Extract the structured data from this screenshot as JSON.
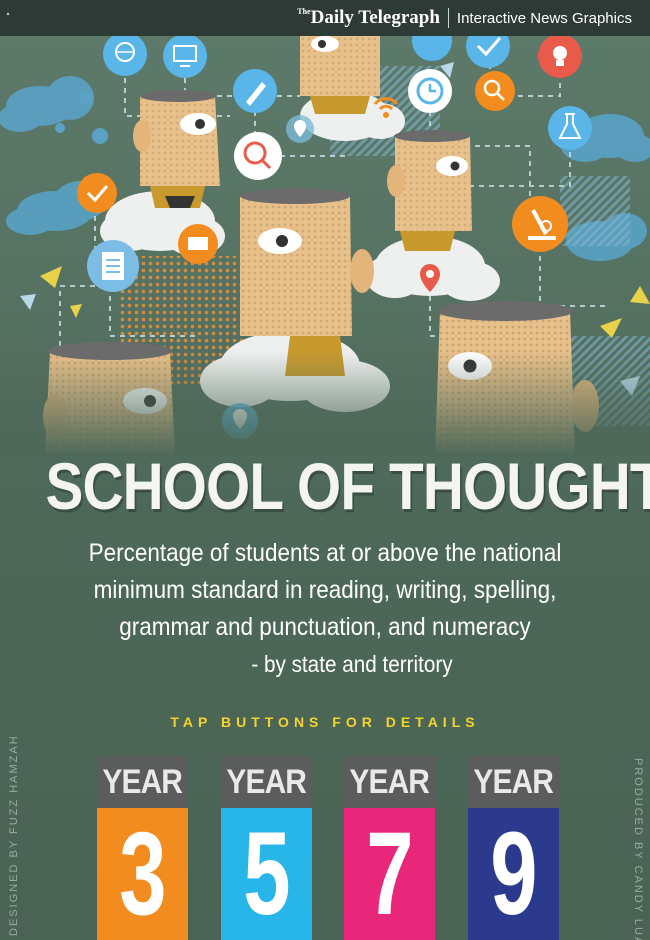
{
  "header": {
    "brand": "Daily Telegraph",
    "brand_prefix": "The",
    "section": "Interactive News Graphics"
  },
  "title": "SCHOOL OF THOUGHT",
  "subtitle": {
    "line1": "Percentage of students at or above the national",
    "line2": "minimum standard in reading, writing, spelling,",
    "line3": "grammar and punctuation, and numeracy",
    "line4": "- by state and territory"
  },
  "tap_hint": "TAP BUTTONS FOR DETAILS",
  "credits": {
    "designed": "DESIGNED BY FUZZ HAMZAH",
    "produced": "PRODUCED BY CANDY LUAN"
  },
  "years": [
    {
      "label": "YEAR",
      "number": "3",
      "color": "#f28c1e"
    },
    {
      "label": "YEAR",
      "number": "5",
      "color": "#28b6e8"
    },
    {
      "label": "YEAR",
      "number": "7",
      "color": "#e8267a"
    },
    {
      "label": "YEAR",
      "number": "9",
      "color": "#2b3a8c"
    }
  ],
  "colors": {
    "background": "#4c6457",
    "header": "#2e3a35",
    "accent_yellow": "#f5d32a"
  }
}
